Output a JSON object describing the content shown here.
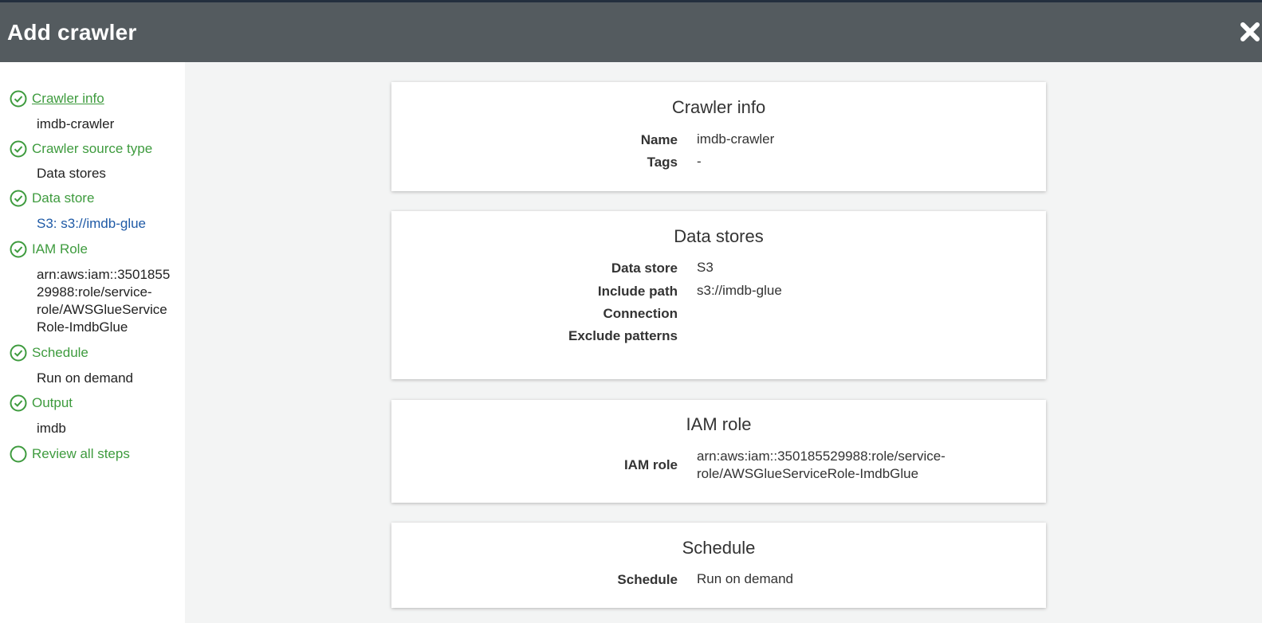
{
  "header": {
    "title": "Add crawler"
  },
  "colors": {
    "header_bg": "#545b5f",
    "step_green": "#3e9b3e",
    "link_blue": "#1f5aa6"
  },
  "steps": [
    {
      "label": "Crawler info",
      "sub": "imdb-crawler",
      "icon": "check-circle-icon"
    },
    {
      "label": "Crawler source type",
      "sub": "Data stores",
      "icon": "check-circle-icon"
    },
    {
      "label": "Data store",
      "sub": "S3: s3://imdb-glue",
      "icon": "check-circle-icon"
    },
    {
      "label": "IAM Role",
      "sub_lines": [
        "arn:aws:iam::3501855",
        "29988:role/service-",
        "role/AWSGlueService",
        "Role-ImdbGlue"
      ],
      "icon": "check-circle-icon"
    },
    {
      "label": "Schedule",
      "sub": "Run on demand",
      "icon": "check-circle-icon"
    },
    {
      "label": "Output",
      "sub": "imdb",
      "icon": "check-circle-icon"
    },
    {
      "label": "Review all steps",
      "icon": "empty-circle-icon"
    }
  ],
  "cards": {
    "crawler_info": {
      "title": "Crawler info",
      "rows": [
        {
          "label": "Name",
          "value": "imdb-crawler"
        },
        {
          "label": "Tags",
          "value": "-"
        }
      ]
    },
    "data_stores": {
      "title": "Data stores",
      "rows": [
        {
          "label": "Data store",
          "value": "S3"
        },
        {
          "label": "Include path",
          "value": "s3://imdb-glue"
        },
        {
          "label": "Connection",
          "value": ""
        },
        {
          "label": "Exclude patterns",
          "value": ""
        }
      ]
    },
    "iam_role": {
      "title": "IAM role",
      "rows": [
        {
          "label": "IAM role",
          "value_lines": [
            "arn:aws:iam::350185529988:role/service-",
            "role/AWSGlueServiceRole-ImdbGlue"
          ]
        }
      ]
    },
    "schedule": {
      "title": "Schedule",
      "rows": [
        {
          "label": "Schedule",
          "value": "Run on demand"
        }
      ]
    }
  }
}
